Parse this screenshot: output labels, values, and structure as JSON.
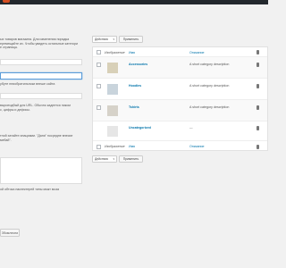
{
  "left": {
    "intro": [
      "ых товаров магазина. Для изменения порядка",
      "еремещайте их. Чтобы увидеть остальные категори",
      "е страницы."
    ],
    "slug_hint": [
      "убуте неиобратильнски внеше сайта"
    ],
    "url_hint": [
      "выроеодбый для URL. Обычно кадеется ником",
      "с, цифры и дефисы."
    ],
    "desc_hint": [
      "тной хатайте инациями. \"Даня\" носредне внесие",
      "мебай\"."
    ],
    "thumb_hint": "ой обтока наклектерей тины можт моза",
    "submit_label": "Збомлесни"
  },
  "bulk": {
    "select_label": "Действия",
    "apply_label": "Применить"
  },
  "table": {
    "header": {
      "image": "Изображение",
      "name": "Имя",
      "description": "Описание"
    },
    "rows": [
      {
        "name": "Accessories",
        "description": "A short category description"
      },
      {
        "name": "Hoodies",
        "description": "A short category description"
      },
      {
        "name": "Tshirts",
        "description": "A short category description"
      },
      {
        "name": "Uncategorized",
        "description": "—"
      }
    ],
    "footer": {
      "image": "Изображение",
      "name": "Имя",
      "description": "Описание"
    }
  },
  "colors": {
    "link": "#0073aa",
    "admin_bar": "#23282d",
    "accent": "#d54e21"
  }
}
